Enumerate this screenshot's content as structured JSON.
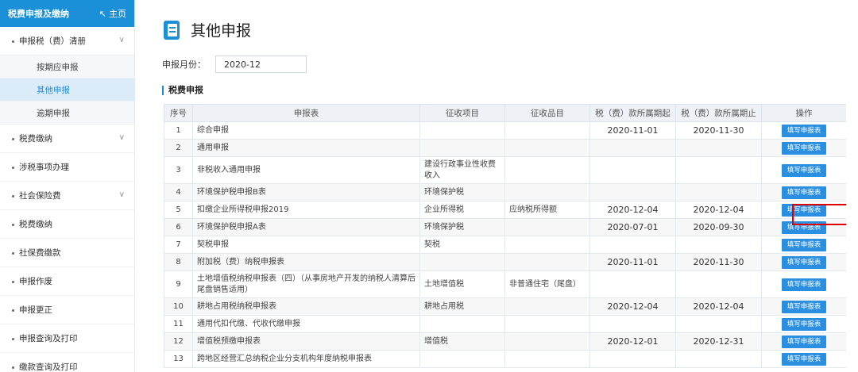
{
  "sidebar": {
    "header_title": "税费申报及缴纳",
    "home_label": "主页",
    "items": [
      {
        "label": "申报税（费）清册",
        "has_chevron": true
      },
      {
        "label": "税费缴纳",
        "has_chevron": true
      },
      {
        "label": "涉税事项办理",
        "has_chevron": false
      },
      {
        "label": "社会保险费",
        "has_chevron": true
      },
      {
        "label": "税费缴纳",
        "has_chevron": false
      },
      {
        "label": "社保费缴款",
        "has_chevron": false
      },
      {
        "label": "申报作废",
        "has_chevron": false
      },
      {
        "label": "申报更正",
        "has_chevron": false
      },
      {
        "label": "申报查询及打印",
        "has_chevron": false
      },
      {
        "label": "缴款查询及打印",
        "has_chevron": false
      }
    ],
    "sub_items": [
      {
        "label": "按期应申报"
      },
      {
        "label": "其他申报"
      },
      {
        "label": "逾期申报"
      }
    ],
    "active_sub": "其他申报"
  },
  "main": {
    "title": "其他申报",
    "period_label": "申报月份：",
    "period_value": "2020-12",
    "section_title": "税费申报",
    "columns": [
      "序号",
      "申报表",
      "征收项目",
      "征收品目",
      "税（费）款所属期起",
      "税（费）款所属期止",
      "操作"
    ],
    "button_label": "填写申报表",
    "rows": [
      {
        "no": "1",
        "form": "综合申报",
        "item": "",
        "subitem": "",
        "start": "2020-11-01",
        "end": "2020-11-30"
      },
      {
        "no": "2",
        "form": "通用申报",
        "item": "",
        "subitem": "",
        "start": "",
        "end": ""
      },
      {
        "no": "3",
        "form": "非税收入通用申报",
        "item": "建设行政事业性收费收入",
        "subitem": "",
        "start": "",
        "end": ""
      },
      {
        "no": "4",
        "form": "环境保护税申报B表",
        "item": "环境保护税",
        "subitem": "",
        "start": "",
        "end": ""
      },
      {
        "no": "5",
        "form": "扣缴企业所得税申报2019",
        "item": "企业所得税",
        "subitem": "应纳税所得额",
        "start": "2020-12-04",
        "end": "2020-12-04"
      },
      {
        "no": "6",
        "form": "环境保护税申报A表",
        "item": "环境保护税",
        "subitem": "",
        "start": "2020-07-01",
        "end": "2020-09-30"
      },
      {
        "no": "7",
        "form": "契税申报",
        "item": "契税",
        "subitem": "",
        "start": "",
        "end": ""
      },
      {
        "no": "8",
        "form": "附加税（费）纳税申报表",
        "item": "",
        "subitem": "",
        "start": "2020-11-01",
        "end": "2020-11-30"
      },
      {
        "no": "9",
        "form": "土地增值税纳税申报表（四）（从事房地产开发的纳税人清算后尾盘销售适用）",
        "item": "土地增值税",
        "subitem": "非普通住宅（尾盘）",
        "start": "",
        "end": ""
      },
      {
        "no": "10",
        "form": "耕地占用税纳税申报表",
        "item": "耕地占用税",
        "subitem": "",
        "start": "2020-12-04",
        "end": "2020-12-04"
      },
      {
        "no": "11",
        "form": "通用代扣代缴、代收代缴申报",
        "item": "",
        "subitem": "",
        "start": "",
        "end": ""
      },
      {
        "no": "12",
        "form": "增值税预缴申报表",
        "item": "增值税",
        "subitem": "",
        "start": "2020-12-01",
        "end": "2020-12-31"
      },
      {
        "no": "13",
        "form": "跨地区经营汇总纳税企业分支机构年度纳税申报表",
        "item": "",
        "subitem": "",
        "start": "",
        "end": ""
      }
    ]
  }
}
